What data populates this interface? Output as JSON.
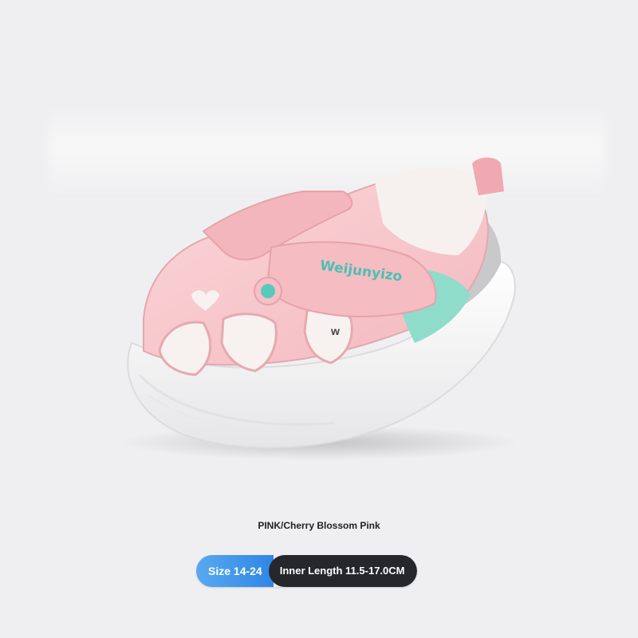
{
  "product": {
    "color_label": "PINK/Cherry Blossom Pink",
    "brand_text": "Weijunyizo",
    "insole_text": "w"
  },
  "size_badge": {
    "size_range": "Size 14-24",
    "inner_length": "Inner Length 11.5-17.0CM"
  },
  "colors": {
    "background": "#efeff1",
    "shoe_pink": "#f7c7cc",
    "accent_mint": "#8fdccb",
    "badge_blue": "#3b8fe8",
    "badge_dark": "#26272b"
  }
}
